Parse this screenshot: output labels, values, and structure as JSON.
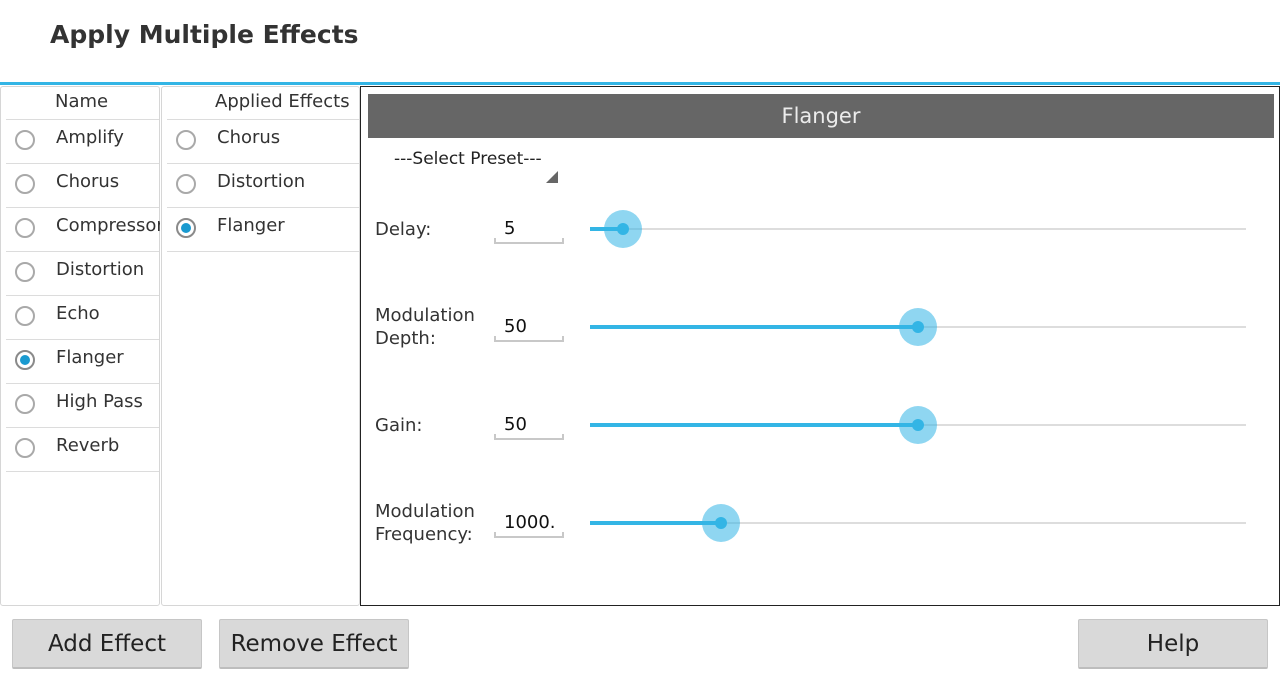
{
  "app": {
    "title": "Apply Multiple Effects"
  },
  "effects_list": {
    "header": "Name",
    "items": [
      {
        "label": "Amplify",
        "checked": false
      },
      {
        "label": "Chorus",
        "checked": false
      },
      {
        "label": "Compressor",
        "checked": false
      },
      {
        "label": "Distortion",
        "checked": false
      },
      {
        "label": "Echo",
        "checked": false
      },
      {
        "label": "Flanger",
        "checked": true
      },
      {
        "label": "High Pass",
        "checked": false
      },
      {
        "label": "Reverb",
        "checked": false
      }
    ]
  },
  "applied_list": {
    "header": "Applied Effects",
    "items": [
      {
        "label": "Chorus",
        "checked": false
      },
      {
        "label": "Distortion",
        "checked": false
      },
      {
        "label": "Flanger",
        "checked": true
      }
    ]
  },
  "effect_panel": {
    "title": "Flanger",
    "preset": "---Select Preset---",
    "params": [
      {
        "label": "Delay:",
        "value": "5",
        "level_percent": 5
      },
      {
        "label": "Modulation\nDepth:",
        "value": "50",
        "level_percent": 50
      },
      {
        "label": "Gain:",
        "value": "50",
        "level_percent": 50
      },
      {
        "label": "Modulation\nFrequency:",
        "value": "1000.",
        "level_percent": 20
      }
    ]
  },
  "buttons": {
    "add": "Add Effect",
    "remove": "Remove Effect",
    "help": "Help"
  },
  "colors": {
    "accent": "#33b5e5",
    "header_gray": "#666666",
    "radio_dot": "#1a9ad0"
  }
}
